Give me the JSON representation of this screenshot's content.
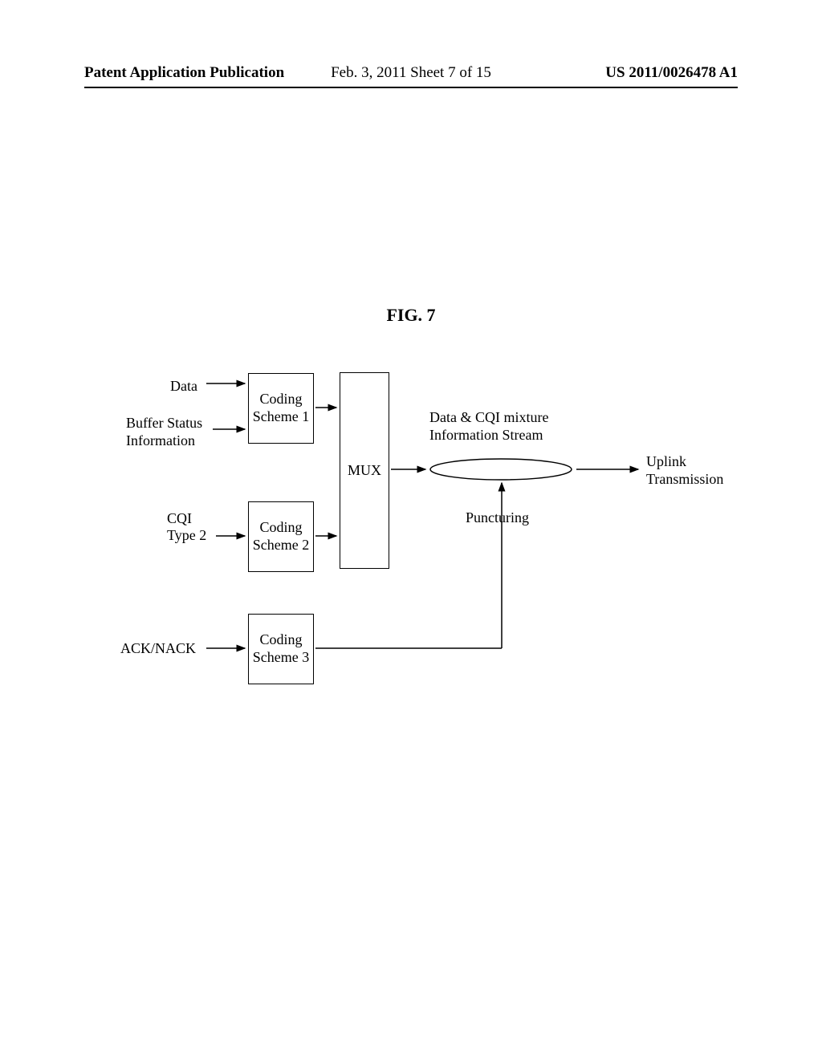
{
  "header": {
    "left": "Patent Application Publication",
    "center": "Feb. 3, 2011   Sheet 7 of 15",
    "right": "US 2011/0026478 A1"
  },
  "figure": {
    "title": "FIG. 7"
  },
  "diagram": {
    "inputs": {
      "data": "Data",
      "buffer_status": "Buffer Status\nInformation",
      "cqi": "CQI\nType 2",
      "ack_nack": "ACK/NACK"
    },
    "blocks": {
      "coding1": "Coding\nScheme 1",
      "coding2": "Coding\nScheme 2",
      "coding3": "Coding\nScheme 3",
      "mux": "MUX"
    },
    "outputs": {
      "mixture": "Data & CQI mixture\nInformation Stream",
      "uplink": "Uplink\nTransmission",
      "puncturing": "Puncturing"
    }
  }
}
